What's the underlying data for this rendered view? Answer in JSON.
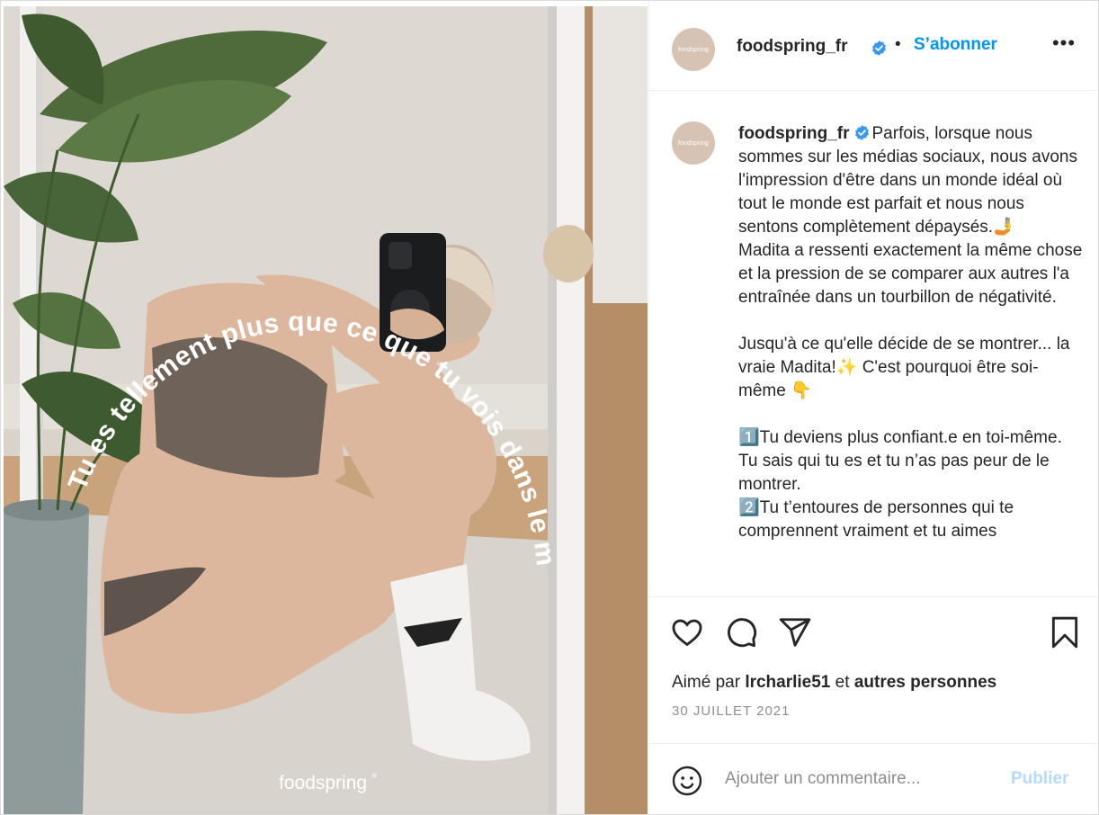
{
  "post": {
    "image": {
      "arc_text": "Tu es tellement plus que ce que tu vois dans le miroir.",
      "watermark": "foodspring",
      "watermark_mark": "®"
    },
    "header": {
      "avatar_text": "foodspring",
      "username": "foodspring_fr",
      "separator": "•",
      "follow_label": "S’abonner",
      "more_label": "•••"
    },
    "caption": {
      "avatar_text": "foodspring",
      "username": "foodspring_fr",
      "text": "Parfois, lorsque nous sommes sur les médias sociaux, nous avons l'impression d'être dans un monde idéal où tout le monde est parfait et nous nous sentons complètement dépaysés.🤳\nMadita a ressenti exactement la même chose et la pression de se comparer aux autres l'a entraînée dans un tourbillon de négativité.\n\nJusqu'à ce qu'elle décide de se montrer... la vraie Madita!✨ C'est pourquoi être soi-même 👇\n\n1️⃣Tu deviens plus confiant.e en toi-même. Tu sais qui tu es et tu n’as pas peur de le montrer.\n2️⃣Tu t’entoures de personnes qui te comprennent vraiment et tu aimes"
    },
    "likes": {
      "prefix": "Aimé par",
      "user": "lrcharlie51",
      "conjunction": "et",
      "others": "autres personnes"
    },
    "date": "30 JUILLET 2021",
    "comment": {
      "placeholder": "Ajouter un commentaire...",
      "publish_label": "Publier"
    },
    "colors": {
      "accent": "#0095f6",
      "verified": "#3897f0",
      "publish_disabled": "#b3dbff",
      "muted": "#8e8e8e",
      "text": "#262626"
    },
    "icons": [
      "heart-icon",
      "comment-icon",
      "share-icon",
      "bookmark-icon",
      "emoji-icon",
      "verified-icon",
      "more-options-icon"
    ]
  }
}
